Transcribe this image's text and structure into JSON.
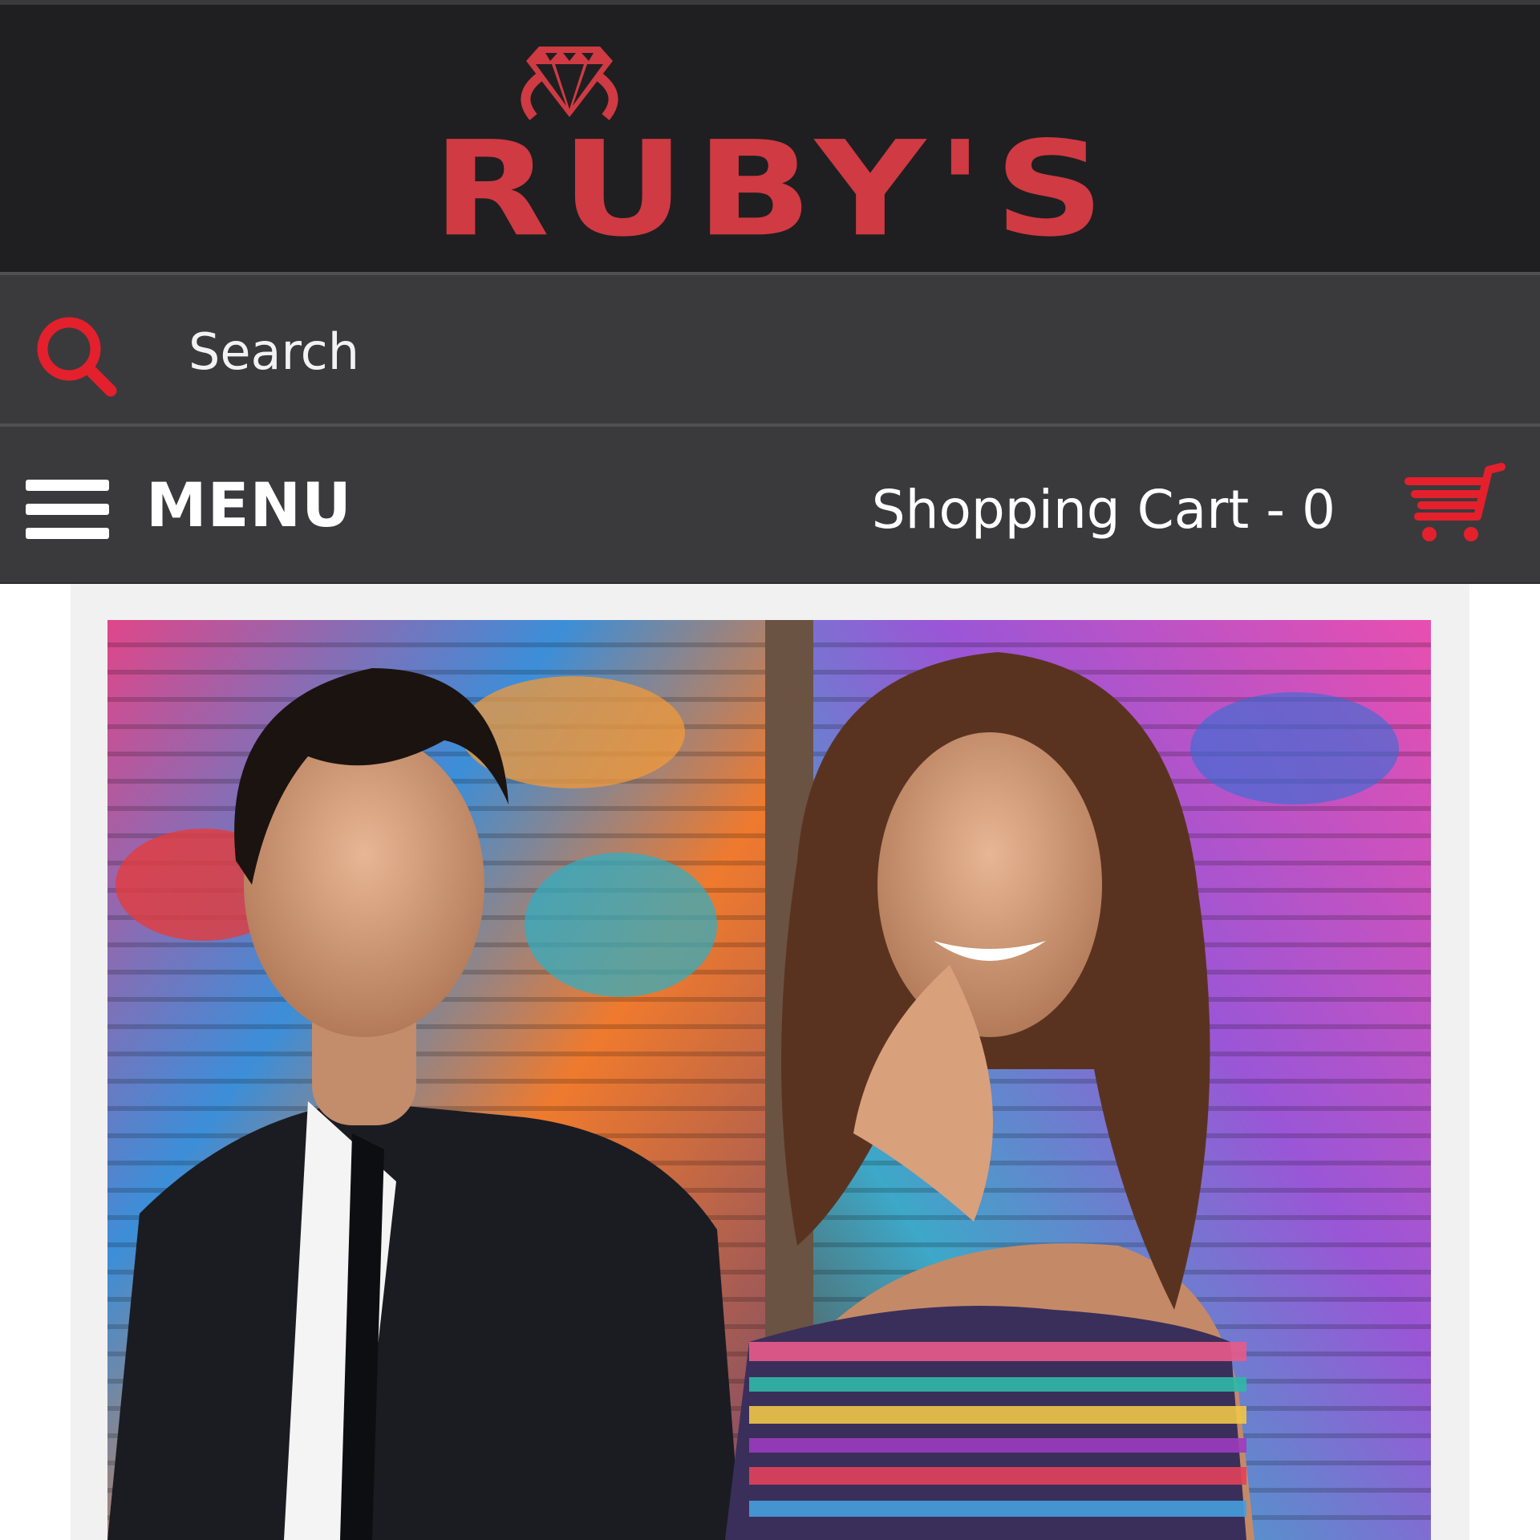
{
  "brand": {
    "name": "RUBY'S",
    "primary_color": "#d03a43",
    "background_color": "#1f1f21"
  },
  "search": {
    "placeholder": "Search",
    "icon": "search-icon"
  },
  "nav": {
    "menu_label": "MENU",
    "menu_icon": "hamburger-icon",
    "cart_label": "Shopping Cart - 0",
    "cart_icon": "shopping-cart-icon"
  },
  "hero": {
    "alt": "Couple in formal wear in front of graffiti wall"
  },
  "colors": {
    "header_dark": "#1f1f21",
    "bar_gray": "#3a3a3d",
    "accent_red": "#d03a43",
    "icon_red": "#e4202c"
  }
}
